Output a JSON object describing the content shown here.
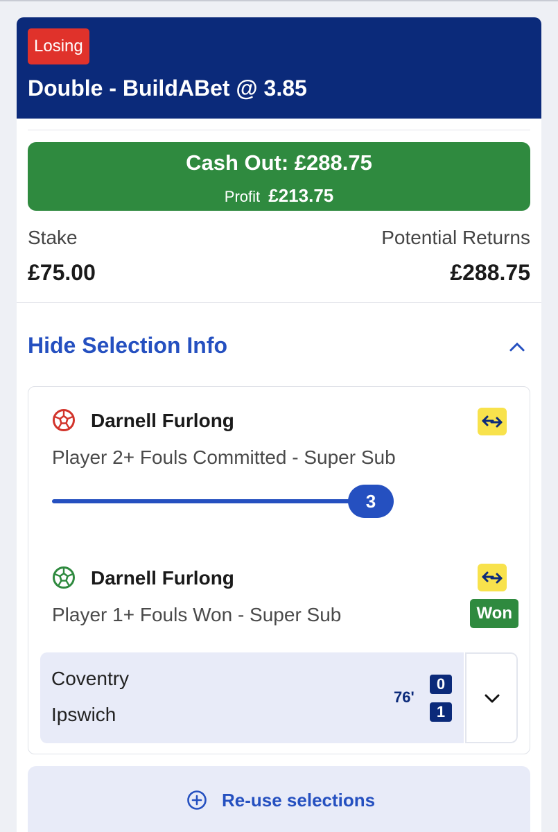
{
  "bet": {
    "status": "Losing",
    "title": "Double - BuildABet @ 3.85"
  },
  "cashout": {
    "label": "Cash Out: £288.75",
    "profit_label": "Profit",
    "profit_value": "£213.75"
  },
  "summary": {
    "stake_label": "Stake",
    "stake_value": "£75.00",
    "returns_label": "Potential Returns",
    "returns_value": "£288.75"
  },
  "toggle": {
    "label": "Hide Selection Info"
  },
  "selections": [
    {
      "player": "Darnell Furlong",
      "market": "Player 2+ Fouls Committed - Super Sub",
      "progress_value": "3",
      "progress_fraction": 1.0,
      "icon_color": "#d2342b",
      "icon": "football-icon"
    },
    {
      "player": "Darnell Furlong",
      "market": "Player 1+ Fouls Won - Super Sub",
      "result": "Won",
      "icon_color": "#2f8a3f",
      "icon": "football-icon"
    }
  ],
  "match": {
    "home_team": "Coventry",
    "away_team": "Ipswich",
    "time": "76'",
    "home_score": "0",
    "away_score": "1"
  },
  "reuse": {
    "label": "Re-use selections"
  },
  "colors": {
    "header": "#0b2a7a",
    "losing": "#e0322b",
    "cashout": "#2f8a3f",
    "link": "#2550c0",
    "swap_icon": "#f8e24c"
  }
}
